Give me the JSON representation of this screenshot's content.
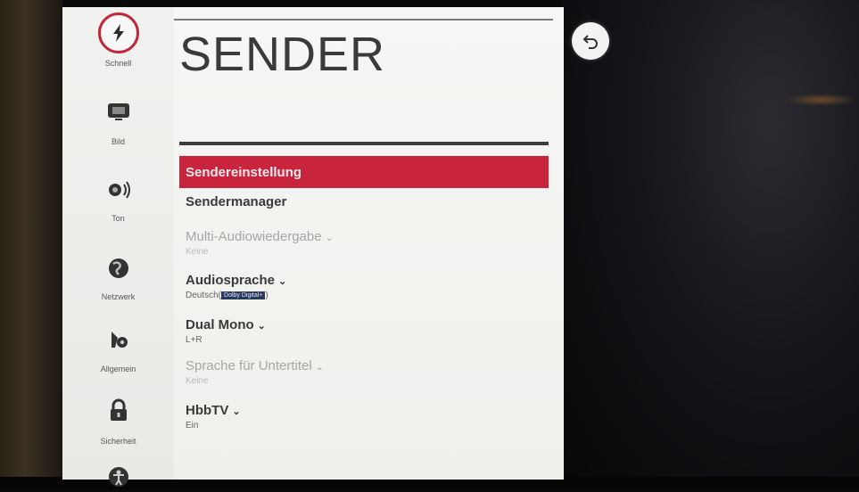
{
  "sidebar": {
    "items": [
      {
        "label": "Schnell",
        "icon": "lightning-icon"
      },
      {
        "label": "Bild",
        "icon": "picture-icon"
      },
      {
        "label": "Ton",
        "icon": "sound-icon"
      },
      {
        "label": "Netzwerk",
        "icon": "globe-icon"
      },
      {
        "label": "Allgemein",
        "icon": "gear-icon"
      },
      {
        "label": "Sicherheit",
        "icon": "lock-icon"
      },
      {
        "label": "",
        "icon": "accessibility-icon"
      }
    ]
  },
  "main": {
    "title": "SENDER",
    "items": [
      {
        "label": "Sendereinstellung",
        "value": ""
      },
      {
        "label": "Sendermanager",
        "value": ""
      },
      {
        "label": "Multi-Audiowiedergabe",
        "value": "Keine"
      },
      {
        "label": "Audiosprache",
        "value": "Deutsch(",
        "tag": "Dolby Digital+",
        "suffix": ")"
      },
      {
        "label": "Dual Mono",
        "value": "L+R"
      },
      {
        "label": "Sprache für Untertitel",
        "value": "Keine"
      },
      {
        "label": "HbbTV",
        "value": "Ein"
      }
    ]
  },
  "colors": {
    "accent": "#c9243e",
    "panel": "#f3f3f1"
  }
}
